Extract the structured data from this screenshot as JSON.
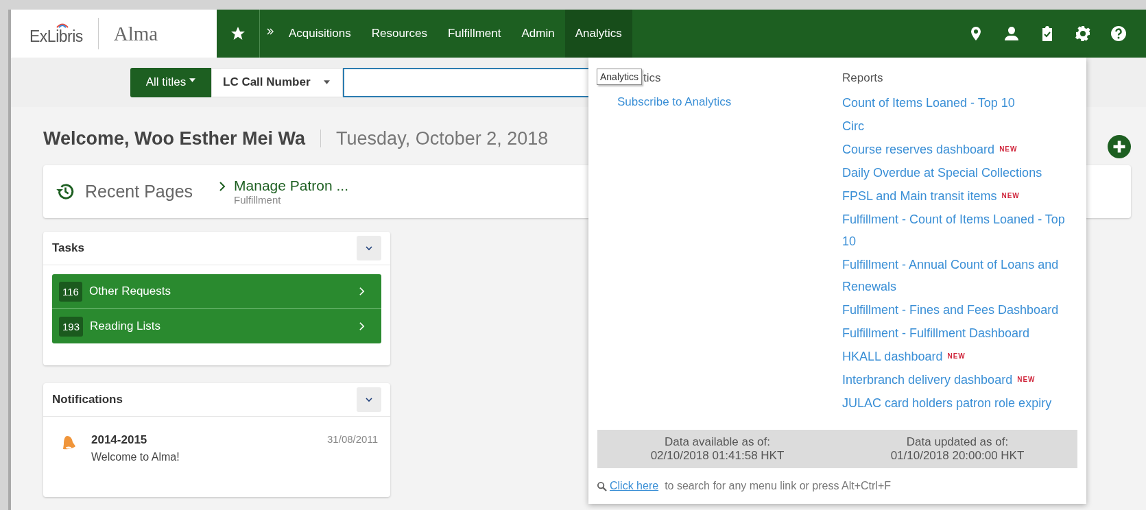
{
  "logo": {
    "brand": "ExLibris",
    "product": "Alma"
  },
  "nav": {
    "items": [
      {
        "label": "Acquisitions",
        "selected": false
      },
      {
        "label": "Resources",
        "selected": false
      },
      {
        "label": "Fulfillment",
        "selected": false
      },
      {
        "label": "Admin",
        "selected": false
      },
      {
        "label": "Analytics",
        "selected": true
      }
    ]
  },
  "search": {
    "scope": "All titles",
    "field": "LC Call Number"
  },
  "welcome": {
    "greeting": "Welcome, Woo Esther Mei Wa",
    "date": "Tuesday, October 2, 2018"
  },
  "recent_pages": {
    "title": "Recent Pages",
    "items": [
      {
        "label": "Manage Patron ...",
        "module": "Fulfillment"
      }
    ]
  },
  "tasks": {
    "title": "Tasks",
    "items": [
      {
        "count": "116",
        "label": "Other Requests"
      },
      {
        "count": "193",
        "label": "Reading Lists"
      }
    ]
  },
  "notifications": {
    "title": "Notifications",
    "items": [
      {
        "title": "2014-2015",
        "date": "31/08/2011",
        "message": "Welcome to Alma!"
      }
    ]
  },
  "analytics_menu": {
    "tooltip": "Analytics",
    "left_header": "tics",
    "left_links": [
      "Subscribe to Analytics"
    ],
    "reports_header": "Reports",
    "reports": [
      {
        "label": "Count of Items Loaned - Top 10"
      },
      {
        "label": "Circ"
      },
      {
        "label": "Course reserves dashboard",
        "badge": "NEW"
      },
      {
        "label": "Daily Overdue at Special Collections"
      },
      {
        "label": "FPSL and Main transit items",
        "badge": "NEW"
      },
      {
        "label": "Fulfillment - Count of Items Loaned - Top 10"
      },
      {
        "label": "Fulfillment - Annual Count of Loans and Renewals"
      },
      {
        "label": "Fulfillment - Fines and Fees Dashboard"
      },
      {
        "label": "Fulfillment - Fulfillment Dashboard"
      },
      {
        "label": "HKALL dashboard",
        "badge": "NEW"
      },
      {
        "label": "Interbranch delivery dashboard",
        "badge": "NEW"
      },
      {
        "label": "JULAC card holders patron role expiry"
      }
    ],
    "data_available": {
      "label": "Data available as of:",
      "value": "02/10/2018 01:41:58 HKT"
    },
    "data_updated": {
      "label": "Data updated as of:",
      "value": "01/10/2018 20:00:00 HKT"
    },
    "footer": {
      "link": "Click here",
      "text": "to search for any menu link or press Alt+Ctrl+F"
    }
  }
}
